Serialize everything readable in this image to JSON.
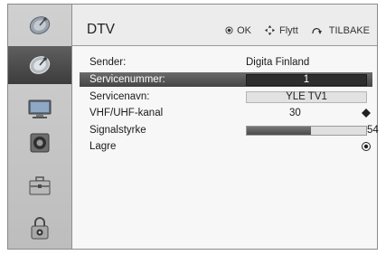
{
  "header": {
    "title": "DTV",
    "hints": [
      {
        "icon": "ok-button-icon",
        "label": "OK"
      },
      {
        "icon": "move-arrows-icon",
        "label": "Flytt"
      },
      {
        "icon": "back-icon",
        "label": "TILBAKE"
      }
    ]
  },
  "sidebar": {
    "items": [
      {
        "icon": "satellite-dish-icon",
        "selected": false
      },
      {
        "icon": "satellite-dish-icon",
        "selected": true
      },
      {
        "icon": "tv-monitor-icon",
        "selected": false
      },
      {
        "icon": "speaker-icon",
        "selected": false
      },
      {
        "icon": "toolbox-icon",
        "selected": false
      },
      {
        "icon": "padlock-icon",
        "selected": false
      }
    ]
  },
  "rows": {
    "sender": {
      "label": "Sender:",
      "value": "Digita Finland"
    },
    "service_number": {
      "label": "Servicenummer:",
      "value": "1"
    },
    "service_name": {
      "label": "Servicenavn:",
      "value": "YLE TV1"
    },
    "channel": {
      "label": "VHF/UHF-kanal",
      "value": "30"
    },
    "signal": {
      "label": "Signalstyrke",
      "value": "54",
      "level_percent": 54
    },
    "save": {
      "label": "Lagre"
    }
  },
  "colors": {
    "selected_row": "#555555",
    "sidebar_bg": "#c8c8c8",
    "value_box_dark": "#2e2e2e"
  }
}
